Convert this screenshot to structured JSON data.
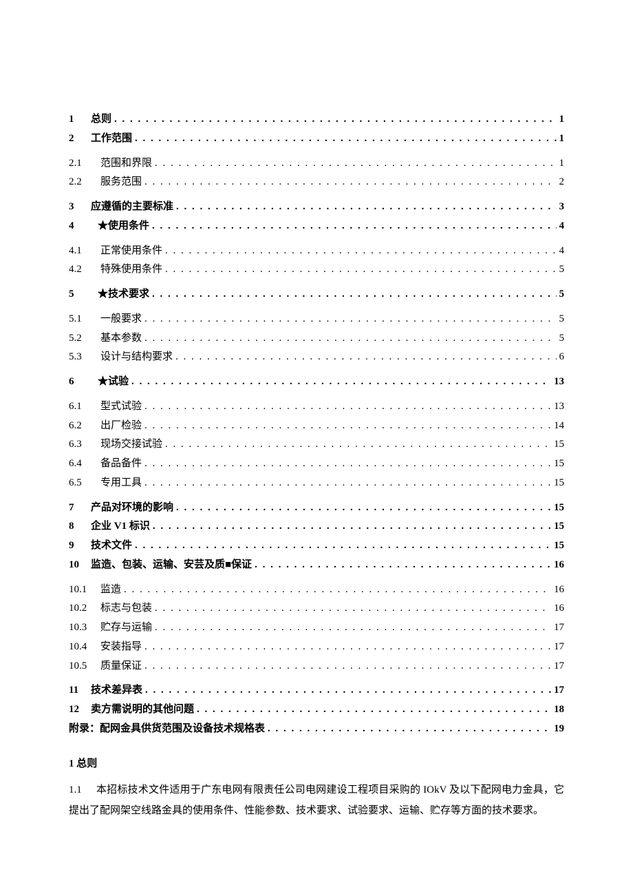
{
  "toc": [
    {
      "type": "main",
      "num": "1",
      "title": "总则",
      "page": "1"
    },
    {
      "type": "main",
      "num": "2",
      "title": "工作范围",
      "page": "1"
    },
    {
      "type": "sub",
      "num": "2.1",
      "title": "范围和界限",
      "page": "1"
    },
    {
      "type": "sub",
      "num": "2.2",
      "title": "服务范围",
      "page": "2"
    },
    {
      "type": "main",
      "num": "3",
      "title": "应遵循的主要标准",
      "page": "3"
    },
    {
      "type": "main",
      "num": "4",
      "title": "★使用条件",
      "page": "4",
      "pad_num": true
    },
    {
      "type": "sub",
      "num": "4.1",
      "title": "正常使用条件",
      "page": "4"
    },
    {
      "type": "sub",
      "num": "4.2",
      "title": "特殊使用条件",
      "page": "5"
    },
    {
      "type": "main",
      "num": "5",
      "title": "★技术要求",
      "page": "5",
      "pad_num": true
    },
    {
      "type": "sub",
      "num": "5.1",
      "title": "一般要求",
      "page": "5"
    },
    {
      "type": "sub",
      "num": "5.2",
      "title": "基本参数",
      "page": "5"
    },
    {
      "type": "sub",
      "num": "5.3",
      "title": "设计与结构要求",
      "page": "6"
    },
    {
      "type": "main",
      "num": "6",
      "title": "★试验",
      "page": "13",
      "pad_num": true
    },
    {
      "type": "sub",
      "num": "6.1",
      "title": "型式试验",
      "page": "13"
    },
    {
      "type": "sub",
      "num": "6.2",
      "title": "出厂检验",
      "page": "14"
    },
    {
      "type": "sub",
      "num": "6.3",
      "title": "现场交接试验",
      "page": "15"
    },
    {
      "type": "sub",
      "num": "6.4",
      "title": "备品备件",
      "page": "15"
    },
    {
      "type": "sub",
      "num": "6.5",
      "title": "专用工具",
      "page": "15"
    },
    {
      "type": "main",
      "num": "7",
      "title": "产品对环境的影响",
      "page": "15"
    },
    {
      "type": "main",
      "num": "8",
      "title": "企业 V1 标识",
      "page": "15"
    },
    {
      "type": "main",
      "num": "9",
      "title": "技术文件",
      "page": "15"
    },
    {
      "type": "main",
      "num": "10",
      "title": "监造、包装、运输、安芸及质■保证",
      "page": "16"
    },
    {
      "type": "sub",
      "num": "10.1",
      "title": "监造",
      "page": "16"
    },
    {
      "type": "sub",
      "num": "10.2",
      "title": "标志与包装",
      "page": "16"
    },
    {
      "type": "sub",
      "num": "10.3",
      "title": "贮存与运输",
      "page": "17"
    },
    {
      "type": "sub",
      "num": "10.4",
      "title": "安装指导",
      "page": "17"
    },
    {
      "type": "sub",
      "num": "10.5",
      "title": "质量保证",
      "page": "17"
    },
    {
      "type": "main",
      "num": "11",
      "title": "技术差异表",
      "page": "17"
    },
    {
      "type": "main",
      "num": "12",
      "title": "卖方需说明的其他问题",
      "page": "18"
    },
    {
      "type": "main",
      "num": "",
      "title": "附录：配网金具供货范围及设备技术规格表",
      "page": "19"
    }
  ],
  "body": {
    "heading_num": "1",
    "heading_title": "总则",
    "para_num": "1.1",
    "para_text": "本招标技术文件适用于广东电网有限责任公司电网建设工程项目采购的 IOkV 及以下配网电力金具，它提出了配网架空线路金具的使用条件、性能参数、技术要求、试验要求、运输、贮存等方面的技术要求。"
  }
}
